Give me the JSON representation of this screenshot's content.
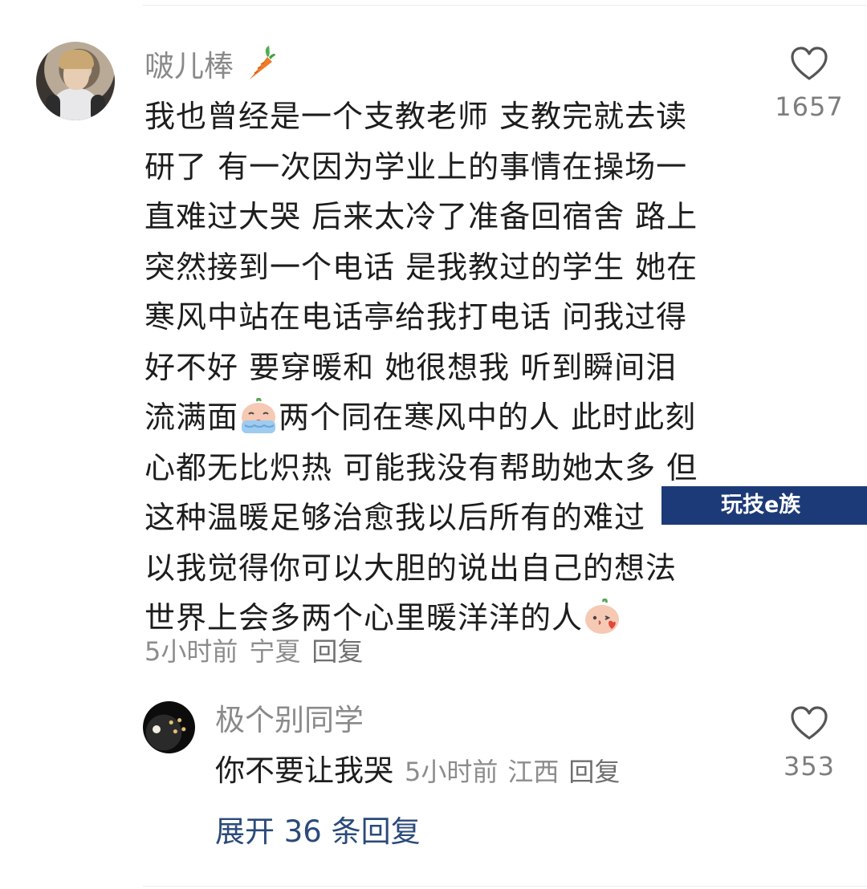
{
  "comment": {
    "username": "啵儿棒",
    "username_emoji": "carrot",
    "lines": [
      "我也曾经是一个支教老师 支教完就去读",
      "研了 有一次因为学业上的事情在操场一",
      "直难过大哭 后来太冷了准备回宿舍 路上",
      "突然接到一个电话 是我教过的学生 她在",
      "寒风中站在电话亭给我打电话 问我过得",
      "好不好 要穿暖和 她很想我 听到瞬间泪",
      "流满面",
      "两个同在寒风中的人 此时此刻",
      "心都无比炽热 可能我没有帮助她太多 但",
      "这种温暖足够治愈我以后所有的难过",
      "以我觉得你可以大胆的说出自己的想法",
      "世界上会多两个心里暖洋洋的人"
    ],
    "time": "5小时前",
    "location": "宁夏",
    "reply_label": "回复",
    "likes": "1657"
  },
  "reply": {
    "username": "极个别同学",
    "text": "你不要让我哭",
    "time": "5小时前",
    "location": "江西",
    "reply_label": "回复",
    "likes": "353"
  },
  "expand_label": "展开 36 条回复",
  "watermark": "玩技e族",
  "colors": {
    "accent_link": "#2b4a7a",
    "watermark_bg": "#1d3a78",
    "meta_gray": "#8c8c8c"
  },
  "icons": [
    "heart-outline-icon",
    "crying-emoji-icon",
    "blowing-kiss-emoji-icon",
    "carrot-icon"
  ]
}
